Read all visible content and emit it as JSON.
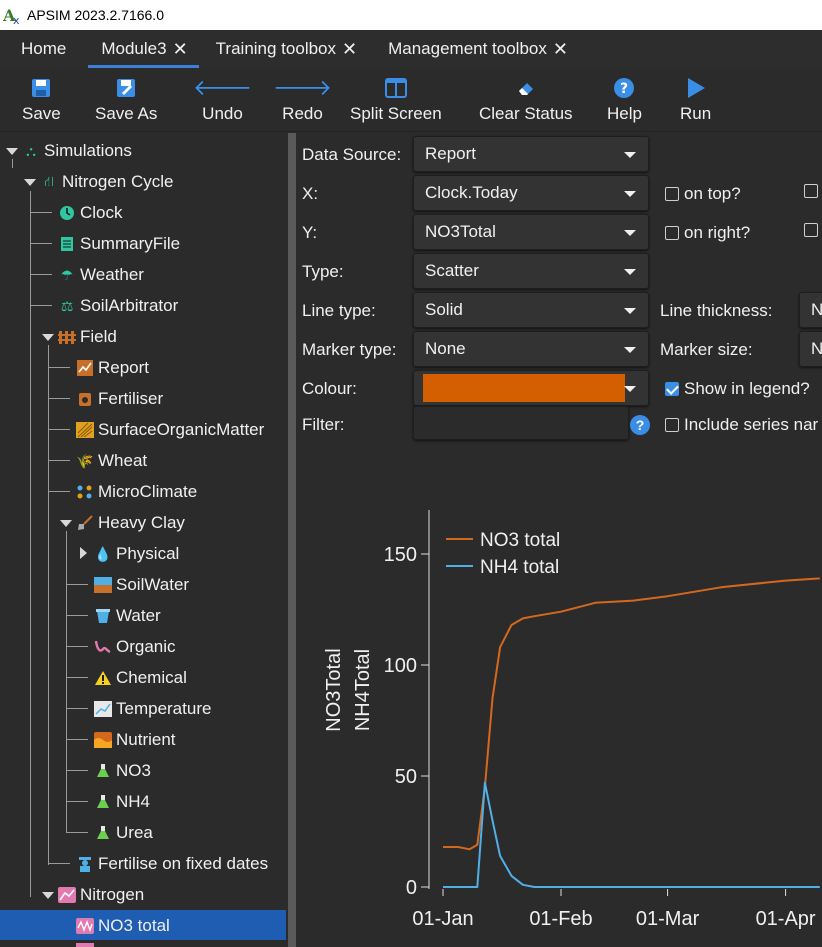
{
  "window": {
    "title": "APSIM 2023.2.7166.0"
  },
  "tabs": [
    {
      "label": "Home",
      "closable": false,
      "active": false
    },
    {
      "label": "Module3",
      "closable": true,
      "active": true
    },
    {
      "label": "Training toolbox",
      "closable": true,
      "active": false
    },
    {
      "label": "Management toolbox",
      "closable": true,
      "active": false
    }
  ],
  "toolbar": {
    "save": "Save",
    "save_as": "Save As",
    "undo": "Undo",
    "redo": "Redo",
    "split_screen": "Split Screen",
    "clear_status": "Clear Status",
    "help": "Help",
    "run": "Run"
  },
  "tree": {
    "simulations": "Simulations",
    "nitrogen_cycle": "Nitrogen Cycle",
    "clock": "Clock",
    "summary_file": "SummaryFile",
    "weather": "Weather",
    "soil_arbitrator": "SoilArbitrator",
    "field": "Field",
    "report": "Report",
    "fertiliser": "Fertiliser",
    "surface_organic_matter": "SurfaceOrganicMatter",
    "wheat": "Wheat",
    "micro_climate": "MicroClimate",
    "heavy_clay": "Heavy Clay",
    "physical": "Physical",
    "soil_water": "SoilWater",
    "water": "Water",
    "organic": "Organic",
    "chemical": "Chemical",
    "temperature": "Temperature",
    "nutrient": "Nutrient",
    "no3": "NO3",
    "nh4": "NH4",
    "urea": "Urea",
    "fertilise_fixed": "Fertilise on fixed dates",
    "nitrogen": "Nitrogen",
    "no3_total": "NO3 total"
  },
  "props": {
    "data_source_label": "Data Source:",
    "data_source_value": "Report",
    "x_label": "X:",
    "x_value": "Clock.Today",
    "y_label": "Y:",
    "y_value": "NO3Total",
    "type_label": "Type:",
    "type_value": "Scatter",
    "line_type_label": "Line type:",
    "line_type_value": "Solid",
    "marker_type_label": "Marker type:",
    "marker_type_value": "None",
    "colour_label": "Colour:",
    "colour_value": "#d45f00",
    "filter_label": "Filter:",
    "filter_value": "",
    "on_top": "on top?",
    "on_right": "on right?",
    "line_thickness_label": "Line thickness:",
    "line_thickness_value": "N",
    "marker_size_label": "Marker size:",
    "marker_size_value": "N",
    "show_in_legend": "Show in legend?",
    "show_in_legend_checked": true,
    "include_series": "Include series nar",
    "help_glyph": "?"
  },
  "chart_data": {
    "type": "line",
    "title": "",
    "xlabel": "",
    "ylabel": [
      "NO3Total",
      "NH4Total"
    ],
    "x_ticks": [
      "01-Jan",
      "01-Feb",
      "01-Mar",
      "01-Apr"
    ],
    "y_ticks": [
      0,
      50,
      100,
      150
    ],
    "ylim": [
      0,
      160
    ],
    "legend_position": "top-left",
    "series": [
      {
        "name": "NO3 total",
        "color": "#d4691e",
        "x": [
          "01-Jan",
          "05-Jan",
          "08-Jan",
          "10-Jan",
          "12-Jan",
          "14-Jan",
          "16-Jan",
          "19-Jan",
          "22-Jan",
          "25-Jan",
          "01-Feb",
          "10-Feb",
          "20-Feb",
          "01-Mar",
          "15-Mar",
          "01-Apr",
          "10-Apr"
        ],
        "values": [
          18,
          18,
          17,
          19,
          45,
          85,
          108,
          118,
          121,
          122,
          124,
          128,
          129,
          131,
          135,
          138,
          139
        ]
      },
      {
        "name": "NH4 total",
        "color": "#4fb0e8",
        "x": [
          "01-Jan",
          "10-Jan",
          "12-Jan",
          "14-Jan",
          "16-Jan",
          "19-Jan",
          "22-Jan",
          "25-Jan",
          "01-Feb",
          "01-Mar",
          "01-Apr",
          "10-Apr"
        ],
        "values": [
          0,
          0,
          47,
          30,
          14,
          5,
          1,
          0,
          0,
          0,
          0,
          0
        ]
      }
    ]
  }
}
